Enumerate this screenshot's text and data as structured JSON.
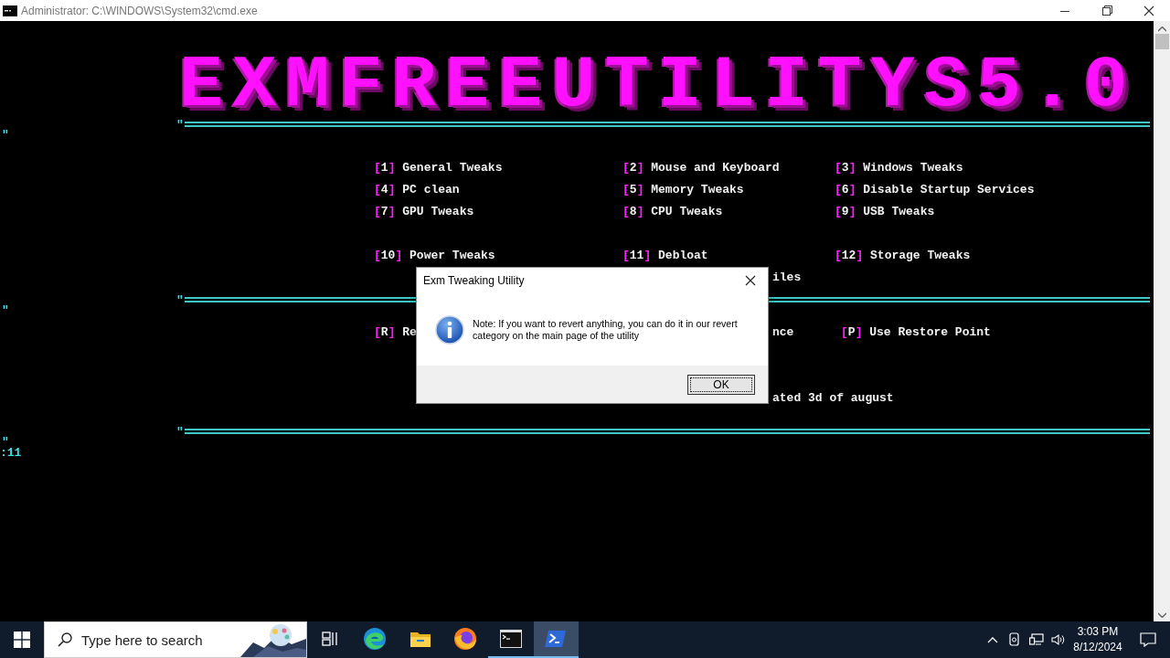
{
  "window": {
    "title": "Administrator: C:\\WINDOWS\\System32\\cmd.exe"
  },
  "console": {
    "rows": [
      {
        "kind": "banner",
        "text": "EXMFREEUTILITYS5.0"
      },
      {
        "kind": "divider",
        "text": "\""
      },
      {
        "kind": "quote",
        "text": "\""
      },
      {
        "kind": "menu",
        "cells": [
          {
            "key": "[1]",
            "label": "General Tweaks"
          },
          {
            "key": "[2]",
            "label": "Mouse and Keyboard"
          },
          {
            "key": "[3]",
            "label": "Windows Tweaks"
          }
        ]
      },
      {
        "kind": "menu",
        "cells": [
          {
            "key": "[4]",
            "label": "PC clean"
          },
          {
            "key": "[5]",
            "label": "Memory Tweaks"
          },
          {
            "key": "[6]",
            "label": "Disable Startup Services"
          }
        ]
      },
      {
        "kind": "menu",
        "cells": [
          {
            "key": "[7]",
            "label": "GPU Tweaks"
          },
          {
            "key": "[8]",
            "label": "CPU Tweaks"
          },
          {
            "key": "[9]",
            "label": "USB Tweaks"
          }
        ]
      },
      {
        "kind": "menu",
        "cells": [
          {
            "key": "[10]",
            "label": "Power Tweaks"
          },
          {
            "key": "[11]",
            "label": "Debloat"
          },
          {
            "key": "[12]",
            "label": "Storage Tweaks"
          }
        ]
      },
      {
        "kind": "menu",
        "cells": [
          {
            "label": "iles"
          }
        ]
      },
      {
        "kind": "divider",
        "text": "\""
      },
      {
        "kind": "quote",
        "text": "\""
      },
      {
        "kind": "menu",
        "cells": [
          {
            "key": "[R]",
            "label": "Re"
          },
          {
            "label": "nce"
          },
          {
            "key": "[P]",
            "label": "Use Restore Point"
          }
        ]
      },
      {
        "kind": "menu",
        "cells": [
          {
            "label": "ated 3d of august"
          }
        ]
      },
      {
        "kind": "divider",
        "text": "\""
      },
      {
        "kind": "quote",
        "text": "\""
      },
      {
        "kind": "prompt",
        "text": ":11"
      }
    ]
  },
  "dialog": {
    "title": "Exm Tweaking Utility",
    "message": "Note: If you want to revert anything, you can do it in our revert category on the main page of the utility",
    "buttons": [
      "OK"
    ]
  },
  "taskbar": {
    "search": {
      "placeholder": "Type here to search"
    },
    "apps": [
      {
        "kind": "taskview",
        "running": false,
        "selected": false
      },
      {
        "kind": "edge",
        "running": false,
        "selected": false
      },
      {
        "kind": "explorer",
        "running": false,
        "selected": false
      },
      {
        "kind": "firefox",
        "running": false,
        "selected": false
      },
      {
        "kind": "cmd",
        "running": true,
        "selected": false
      },
      {
        "kind": "powershell",
        "running": true,
        "selected": true
      }
    ],
    "time": "3:03 PM",
    "date": "8/12/2024"
  }
}
